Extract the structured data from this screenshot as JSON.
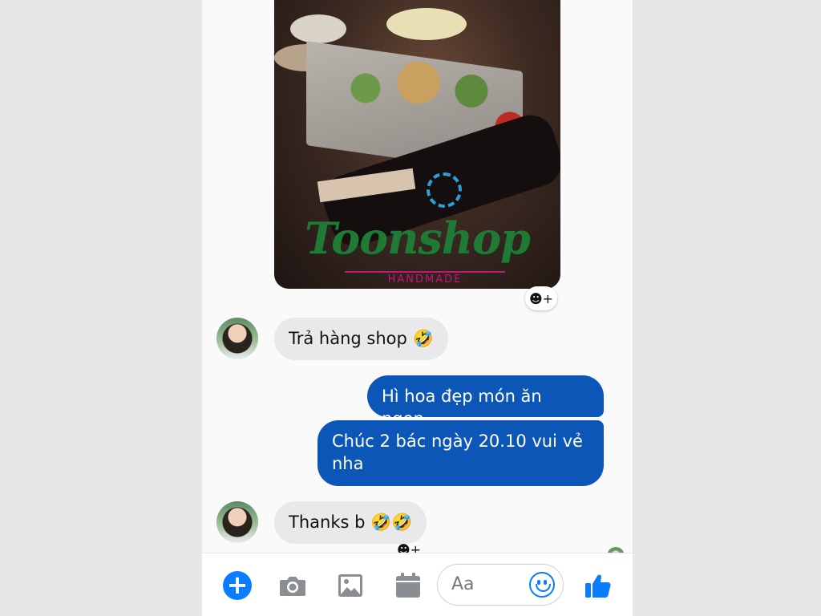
{
  "conversation": {
    "messages": [
      {
        "side": "incoming",
        "text": "Trả hàng shop 🤣"
      },
      {
        "side": "outgoing",
        "text": "Hì hoa đẹp món ăn ngon"
      },
      {
        "side": "outgoing",
        "text": "Chúc 2 bác ngày 20.10 vui vẻ nha"
      },
      {
        "side": "incoming",
        "text": "Thanks b 🤣🤣"
      }
    ],
    "photo": {
      "logo_text": "Toonshop",
      "logo_subtext": "HANDMADE"
    },
    "react_label": "☻+"
  },
  "composer": {
    "placeholder": "Aa",
    "icons": [
      "plus-icon",
      "camera-icon",
      "image-icon",
      "calendar-icon",
      "emoji-icon",
      "thumbs-up-icon"
    ]
  },
  "colors": {
    "outgoing_bubble": "#0c56b8",
    "incoming_bubble": "#e9e9eb",
    "accent": "#0a7cff"
  }
}
